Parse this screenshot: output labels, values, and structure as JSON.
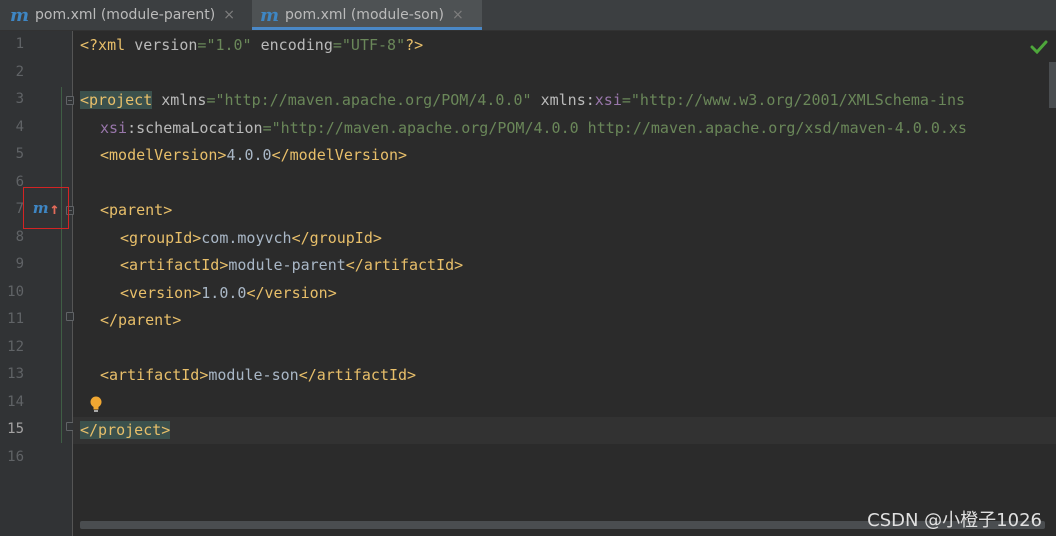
{
  "tabs": [
    {
      "icon": "maven-icon",
      "label": "pom.xml (module-parent)",
      "close": "×",
      "active": false
    },
    {
      "icon": "maven-icon",
      "label": "pom.xml (module-son)",
      "close": "×",
      "active": true
    }
  ],
  "line_numbers": [
    "1",
    "2",
    "3",
    "4",
    "5",
    "6",
    "7",
    "8",
    "9",
    "10",
    "11",
    "12",
    "13",
    "14",
    "15",
    "16"
  ],
  "current_line": "15",
  "gutter_marker": {
    "letter": "m",
    "arrow": "↑",
    "meaning": "navigate-to-parent-pom"
  },
  "code": {
    "l1": {
      "open": "<?xml ",
      "a1": "version",
      "eq1": "=",
      "v1": "\"1.0\"",
      "sp": " ",
      "a2": "encoding",
      "eq2": "=",
      "v2": "\"UTF-8\"",
      "close": "?>"
    },
    "l3": {
      "open": "<project",
      "sp1": " ",
      "a1": "xmlns",
      "eq1": "=",
      "v1": "\"http://maven.apache.org/POM/4.0.0\"",
      "sp2": " ",
      "a2": "xmlns:",
      "ns2": "xsi",
      "eq2": "=",
      "v2": "\"http://www.w3.org/2001/XMLSchema-ins"
    },
    "l4": {
      "ns": "xsi",
      "a": ":schemaLocation",
      "eq": "=",
      "v": "\"http://maven.apache.org/POM/4.0.0 http://maven.apache.org/xsd/maven-4.0.0.xs"
    },
    "l5": {
      "open": "<modelVersion>",
      "text": "4.0.0",
      "close": "</modelVersion>"
    },
    "l7": {
      "open": "<parent>"
    },
    "l8": {
      "open": "<groupId>",
      "text": "com.moyvch",
      "close": "</groupId>"
    },
    "l9": {
      "open": "<artifactId>",
      "text": "module-parent",
      "close": "</artifactId>"
    },
    "l10": {
      "open": "<version>",
      "text": "1.0.0",
      "close": "</version>"
    },
    "l11": {
      "close": "</parent>"
    },
    "l13": {
      "open": "<artifactId>",
      "text": "module-son",
      "close": "</artifactId>"
    },
    "l15": {
      "close": "</project>"
    }
  },
  "colors": {
    "background": "#2b2b2b",
    "tag": "#e8bf6a",
    "attribute": "#bababa",
    "namespace": "#9876aa",
    "string": "#6a8759",
    "text": "#a9b7c6",
    "maven_blue": "#3e86c4",
    "marker_border": "#d32424"
  },
  "watermark": "CSDN @小橙子1026"
}
